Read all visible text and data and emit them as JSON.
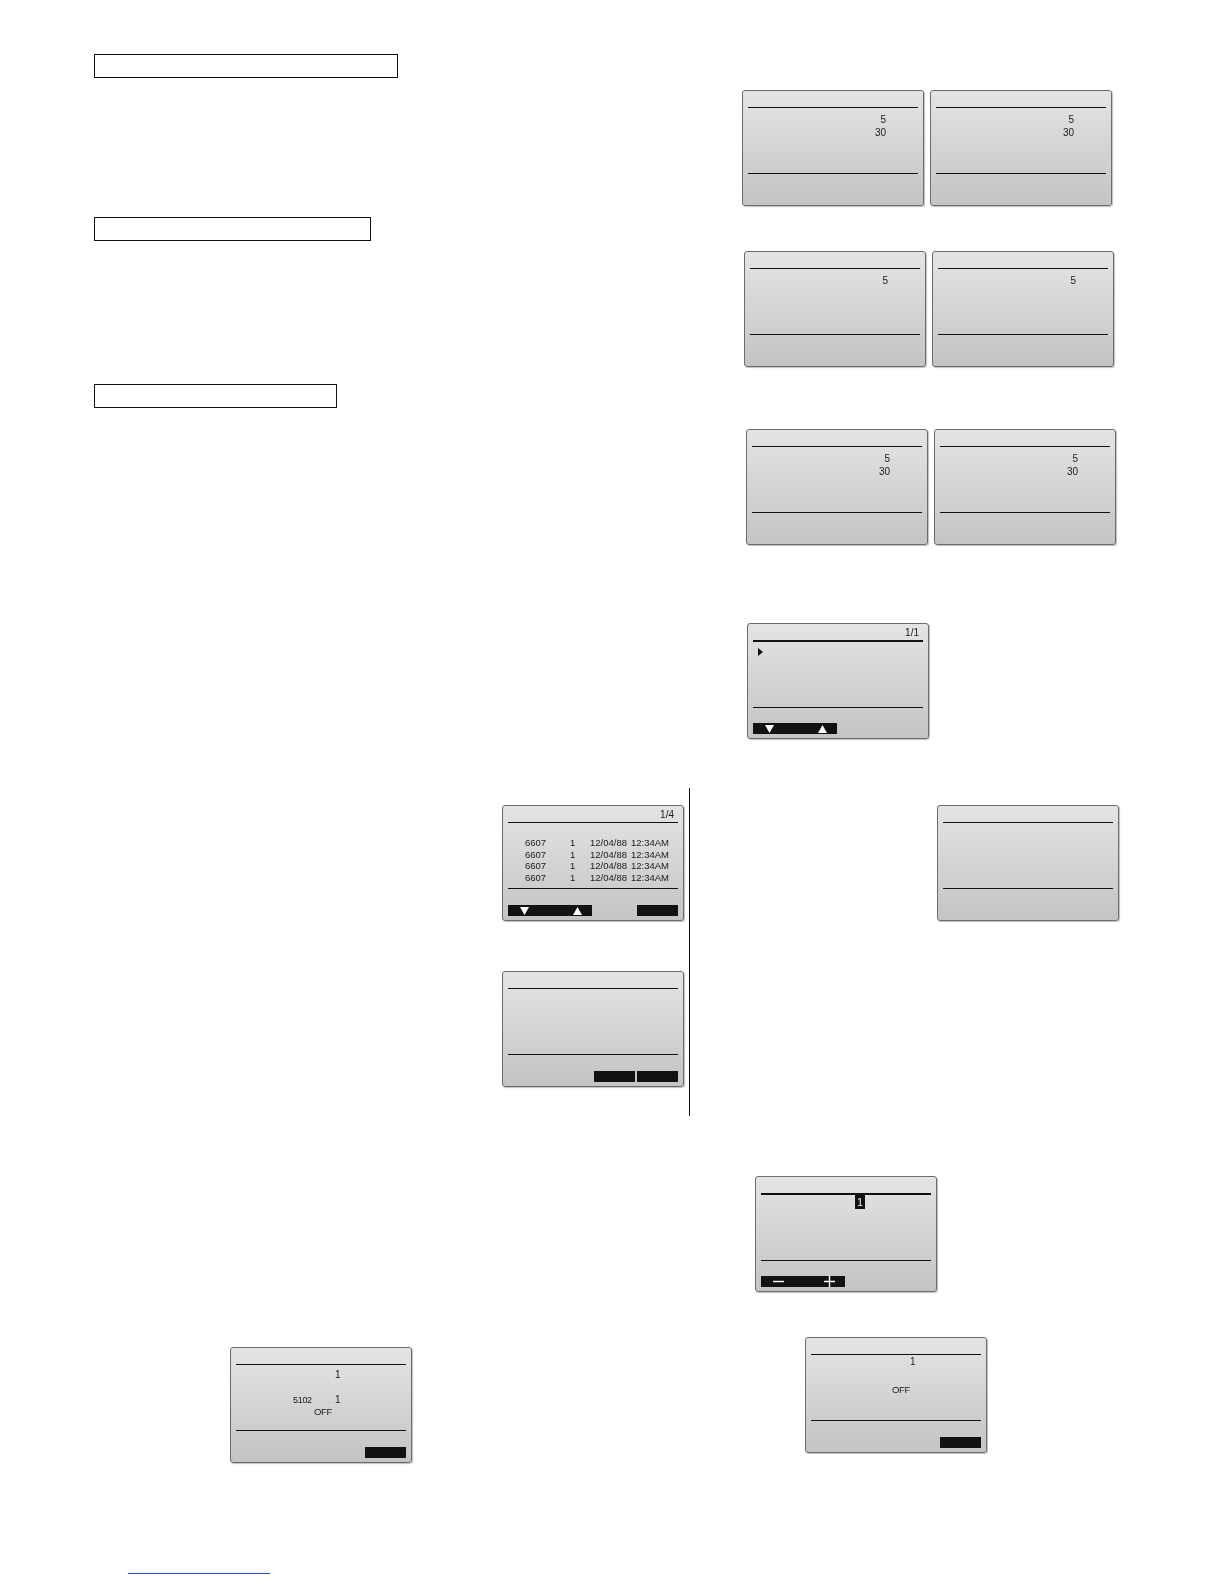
{
  "right_column": {
    "screen_pairs": [
      [
        {
          "kind": "setting",
          "values": [
            "5",
            "30"
          ]
        },
        {
          "kind": "setting",
          "values": [
            "5",
            "30"
          ]
        }
      ],
      [
        {
          "kind": "setting",
          "values": [
            "5"
          ]
        },
        {
          "kind": "setting",
          "values": [
            "5"
          ]
        }
      ],
      [
        {
          "kind": "setting",
          "values": [
            "5",
            "30"
          ]
        },
        {
          "kind": "setting",
          "values": [
            "5",
            "30"
          ]
        }
      ]
    ],
    "list_screen": {
      "kind": "list",
      "page": "1/1",
      "keys": [
        {
          "kind": "scroll"
        }
      ]
    }
  },
  "error_history": {
    "history_screen": {
      "kind": "history",
      "page": "1/4",
      "rows": [
        {
          "code": "6607",
          "unit": "1",
          "date": "12/04/88",
          "time": "12:34AM"
        },
        {
          "code": "6607",
          "unit": "1",
          "date": "12/04/88",
          "time": "12:34AM"
        },
        {
          "code": "6607",
          "unit": "1",
          "date": "12/04/88",
          "time": "12:34AM"
        },
        {
          "code": "6607",
          "unit": "1",
          "date": "12/04/88",
          "time": "12:34AM"
        }
      ],
      "keys": [
        {
          "kind": "scroll"
        },
        {
          "kind": "blank"
        }
      ]
    },
    "confirm_screen": {
      "kind": "blank",
      "keys": [
        {
          "kind": "blank"
        },
        {
          "kind": "blank"
        }
      ]
    }
  },
  "side_screen": {
    "kind": "blank"
  },
  "edit_screen": {
    "kind": "edit",
    "value": "1",
    "highlighted": true,
    "keys": [
      {
        "kind": "adjust"
      }
    ]
  },
  "status_screen": {
    "kind": "status",
    "unit": "1",
    "code": "5102",
    "code_unit": "1",
    "state": "OFF",
    "keys": [
      {
        "kind": "blank"
      }
    ]
  },
  "result_screen": {
    "kind": "result",
    "unit": "1",
    "state": "OFF",
    "keys": [
      {
        "kind": "blank"
      }
    ]
  }
}
